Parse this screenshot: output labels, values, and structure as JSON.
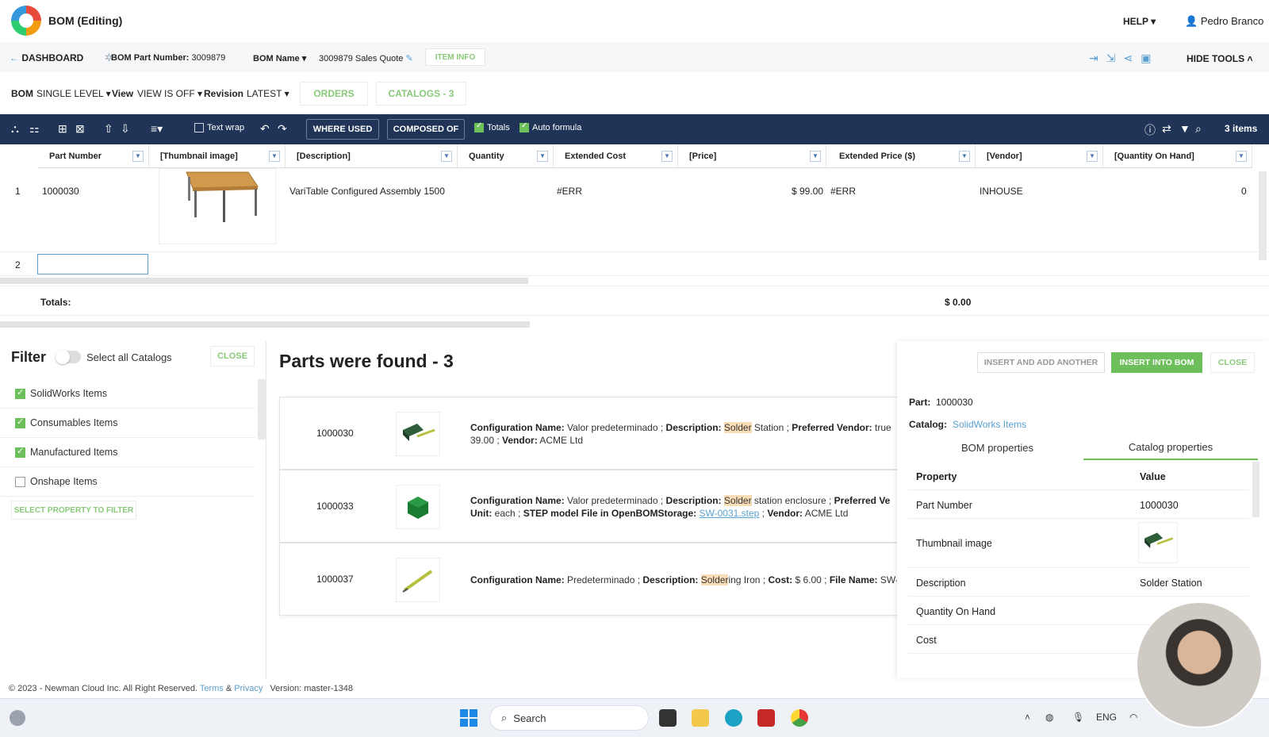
{
  "app": {
    "title": "BOM (Editing)",
    "help": "HELP",
    "user": "Pedro Branco"
  },
  "nav": {
    "dashboard": "DASHBOARD",
    "part_number_label": "BOM Part Number:",
    "part_number_value": "3009879",
    "bom_name_label": "BOM Name",
    "bom_name_value": "3009879 Sales Quote",
    "item_info": "ITEM INFO",
    "hide_tools": "HIDE TOOLS"
  },
  "bombar": {
    "bom_label": "BOM",
    "bom_value": "SINGLE LEVEL",
    "view_label": "View",
    "view_value": "VIEW IS OFF",
    "revision_label": "Revision",
    "revision_value": "LATEST",
    "tab_orders": "ORDERS",
    "tab_catalogs": "CATALOGS - 3"
  },
  "toolbar": {
    "text_wrap": "Text wrap",
    "where_used": "WHERE USED",
    "composed_of": "COMPOSED OF",
    "totals": "Totals",
    "auto_formula": "Auto formula",
    "items_count": "3 items"
  },
  "grid": {
    "columns": [
      "Part Number",
      "[Thumbnail image]",
      "[Description]",
      "Quantity",
      "Extended Cost",
      "[Price]",
      "Extended Price ($)",
      "[Vendor]",
      "[Quantity On Hand]"
    ],
    "rows": [
      {
        "index": "1",
        "part_number": "1000030",
        "description": "VariTable Configured Assembly 1500",
        "quantity": "",
        "extended_cost": "#ERR",
        "price": "$ 99.00",
        "extended_price": "#ERR",
        "vendor": "INHOUSE",
        "qoh": "0"
      },
      {
        "index": "2",
        "part_number": "",
        "description": "",
        "quantity": "",
        "extended_cost": "",
        "price": "",
        "extended_price": "",
        "vendor": "",
        "qoh": ""
      }
    ],
    "totals_label": "Totals:",
    "totals_extended_price": "$ 0.00"
  },
  "filter": {
    "title": "Filter",
    "select_all": "Select all Catalogs",
    "close": "CLOSE",
    "items": [
      {
        "label": "SolidWorks Items",
        "checked": true
      },
      {
        "label": "Consumables Items",
        "checked": true
      },
      {
        "label": "Manufactured Items",
        "checked": true
      },
      {
        "label": "Onshape Items",
        "checked": false
      }
    ],
    "select_property": "SELECT PROPERTY TO FILTER"
  },
  "results": {
    "title": "Parts were found - 3",
    "cards": [
      {
        "part_number": "1000030",
        "l1_a": "Configuration Name:",
        "l1_b": " Valor predeterminado ; ",
        "l1_c": "Description:",
        "l1_d": "Solder",
        "l1_e": " Station ; ",
        "l1_f": "Preferred Vendor:",
        "l1_g": " true",
        "l2_a": "39.00 ; ",
        "l2_b": "Vendor:",
        "l2_c": " ACME Ltd"
      },
      {
        "part_number": "1000033",
        "l1_a": "Configuration Name:",
        "l1_b": " Valor predeterminado ; ",
        "l1_c": "Description:",
        "l1_d": "Solder",
        "l1_e": " station enclosure ; ",
        "l1_f": "Preferred Ve",
        "l1_g": "",
        "l2_a": "Unit:",
        "l2_b": " each ; ",
        "l2_c": "STEP model File in OpenBOMStorage:",
        "l2_d": "SW-0031.step",
        "l2_e": " ; ",
        "l2_f": "Vendor:",
        "l2_g": " ACME Ltd"
      },
      {
        "part_number": "1000037",
        "l1_a": "Configuration Name:",
        "l1_b": " Predeterminado ; ",
        "l1_c": "Description:",
        "l1_d": "Solder",
        "l1_e": "ing Iron ; ",
        "l1_f": "Cost:",
        "l1_g": " $ 6.00 ; ",
        "l1_h": "File Name:",
        "l1_i": " SW-"
      }
    ]
  },
  "detail": {
    "insert_add_another": "INSERT AND ADD ANOTHER",
    "insert_into_bom": "INSERT INTO BOM",
    "close": "CLOSE",
    "part_label": "Part:",
    "part_value": "1000030",
    "catalog_label": "Catalog:",
    "catalog_value": "SolidWorks Items",
    "tab_bom": "BOM properties",
    "tab_catalog": "Catalog properties",
    "col_property": "Property",
    "col_value": "Value",
    "rows": [
      {
        "property": "Part Number",
        "value": "1000030"
      },
      {
        "property": "Thumbnail image",
        "value": ""
      },
      {
        "property": "Description",
        "value": "Solder Station"
      },
      {
        "property": "Quantity On Hand",
        "value": ""
      },
      {
        "property": "Cost",
        "value": ""
      }
    ]
  },
  "footer": {
    "copyright": "© 2023 - Newman Cloud Inc. All Right Reserved.",
    "terms": "Terms",
    "amp": "&",
    "privacy": "Privacy",
    "version": "Version: master-1348"
  },
  "taskbar": {
    "search": "Search",
    "lang": "ENG"
  },
  "colors": {
    "accent_green": "#6cbf5a",
    "toolbar_navy": "#1f3456",
    "link_blue": "#5aa0d0",
    "highlight": "#f9ddb6"
  }
}
